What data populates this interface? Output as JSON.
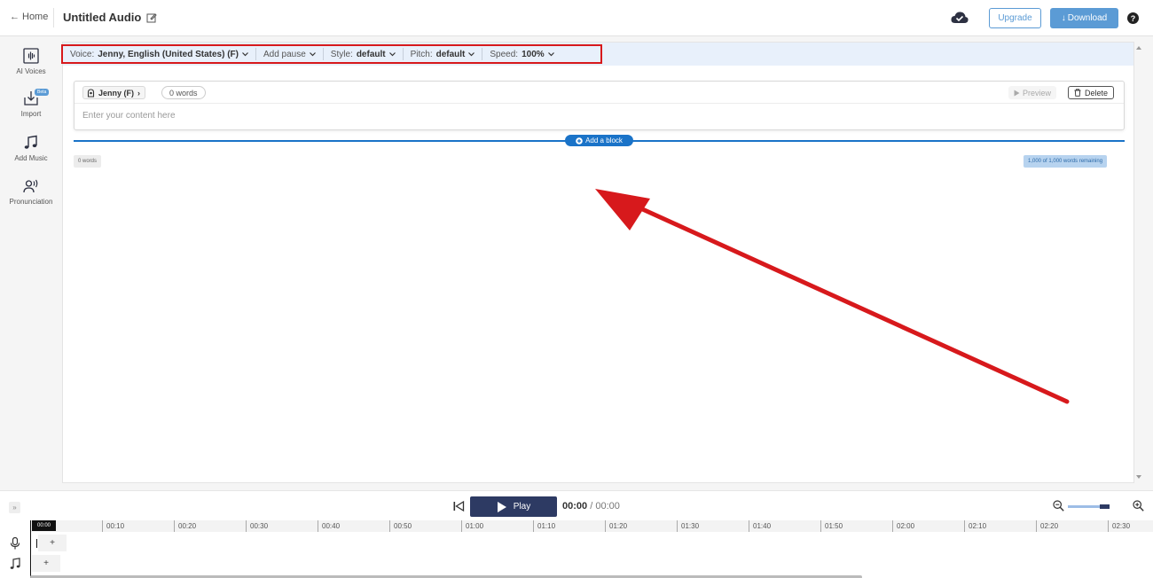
{
  "header": {
    "home_label": "Home",
    "title": "Untitled Audio",
    "upgrade_label": "Upgrade",
    "download_label": "Download",
    "help_label": "?"
  },
  "sidebar": {
    "items": [
      {
        "label": "AI Voices",
        "icon": "waveform-icon"
      },
      {
        "label": "Import",
        "icon": "import-icon",
        "badge": "Beta"
      },
      {
        "label": "Add Music",
        "icon": "music-note-icon"
      },
      {
        "label": "Pronunciation",
        "icon": "speaking-person-icon"
      }
    ]
  },
  "toolbar": {
    "voice_label": "Voice:",
    "voice_value": "Jenny, English (United States) (F)",
    "add_pause_label": "Add pause",
    "style_label": "Style:",
    "style_value": "default",
    "pitch_label": "Pitch:",
    "pitch_value": "default",
    "speed_label": "Speed:",
    "speed_value": "100%"
  },
  "block": {
    "voice_chip": "Jenny (F)",
    "word_count": "0 words",
    "preview_label": "Preview",
    "delete_label": "Delete",
    "placeholder": "Enter your content here"
  },
  "editor": {
    "add_block_label": "Add a block",
    "total_words": "0 words",
    "remaining": "1,000 of 1,000 words remaining"
  },
  "player": {
    "play_label": "Play",
    "current_time": "00:00",
    "separator": "/",
    "total_time": "00:00",
    "playhead_label": "00:00",
    "ruler_ticks": [
      "00:10",
      "00:20",
      "00:30",
      "00:40",
      "00:50",
      "01:00",
      "01:10",
      "01:20",
      "01:30",
      "01:40",
      "01:50",
      "02:00",
      "02:10",
      "02:20",
      "02:30"
    ],
    "track_add_label": "+",
    "collapse_label": "»"
  },
  "colors": {
    "accent": "#5b9bd5",
    "primary_blue": "#1a73c8",
    "play_button": "#2d3a63",
    "annotation_red": "#d7191c"
  }
}
